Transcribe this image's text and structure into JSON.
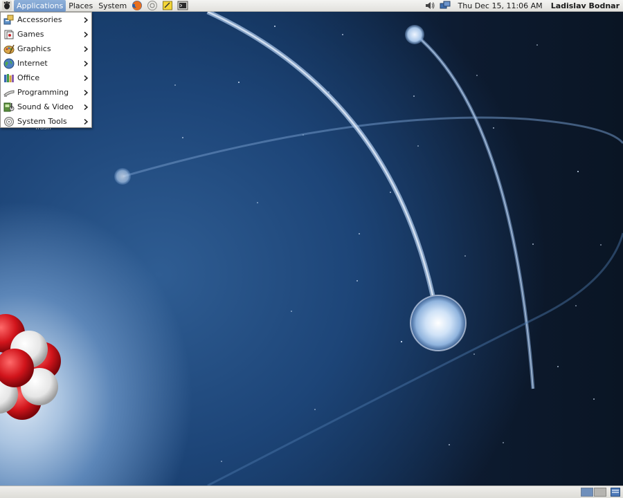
{
  "top_panel": {
    "menus": [
      {
        "label": "Applications"
      },
      {
        "label": "Places"
      },
      {
        "label": "System"
      }
    ],
    "launchers": [
      "firefox-icon",
      "mail-icon",
      "notes-icon",
      "terminal-icon"
    ],
    "tray": [
      "volume-icon",
      "network-icon"
    ],
    "clock": "Thu Dec 15, 11:06 AM",
    "user": "Ladislav Bodnar"
  },
  "applications_menu": {
    "items": [
      {
        "label": "Accessories",
        "icon": "accessories-icon"
      },
      {
        "label": "Games",
        "icon": "games-icon"
      },
      {
        "label": "Graphics",
        "icon": "graphics-icon"
      },
      {
        "label": "Internet",
        "icon": "internet-icon"
      },
      {
        "label": "Office",
        "icon": "office-icon"
      },
      {
        "label": "Programming",
        "icon": "programming-icon"
      },
      {
        "label": "Sound & Video",
        "icon": "sound-video-icon"
      },
      {
        "label": "System Tools",
        "icon": "system-tools-icon"
      }
    ]
  },
  "desktop": {
    "trash_label": "Trash"
  },
  "bottom_panel": {
    "workspaces": [
      "workspace-1",
      "workspace-2"
    ]
  },
  "colors": {
    "menu_highlight": "#7fa3d1",
    "desktop_deep": "#0b1626",
    "desktop_glow": "#dce8f5"
  }
}
